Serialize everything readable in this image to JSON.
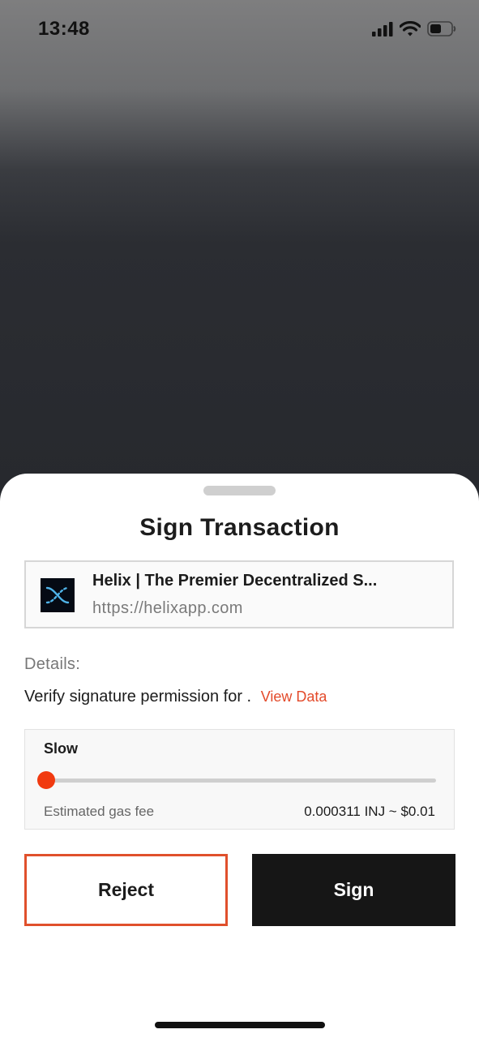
{
  "status_bar": {
    "time": "13:48",
    "icons": [
      "cellular-signal-icon",
      "wifi-icon",
      "battery-icon"
    ]
  },
  "sheet": {
    "title": "Sign Transaction",
    "site": {
      "icon": "helix-logo-icon",
      "title": "Helix | The Premier Decentralized S...",
      "url": "https://helixapp.com"
    },
    "details_label": "Details:",
    "details_text": "Verify signature permission for .",
    "view_data_link": "View Data",
    "fee": {
      "speed_label": "Slow",
      "speed_level": 0,
      "estimated_label": "Estimated gas fee",
      "estimated_value": "0.000311 INJ ~ $0.01"
    },
    "buttons": {
      "reject": "Reject",
      "sign": "Sign"
    }
  },
  "colors": {
    "accent": "#e34a2a",
    "slider_thumb": "#f13a10",
    "sign_button": "#161616",
    "logo_bg": "#050a14",
    "logo_stroke": "#4fb3e8"
  }
}
